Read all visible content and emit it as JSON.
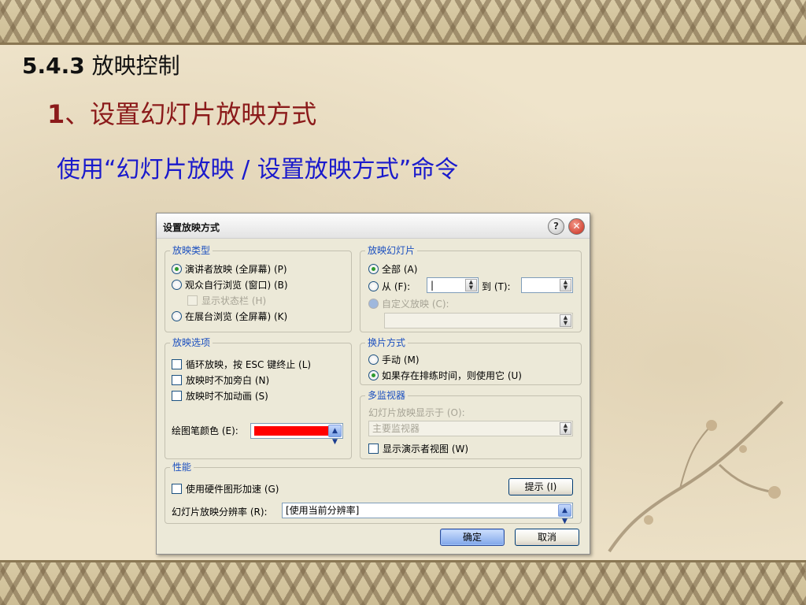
{
  "slide": {
    "heading1_num": "5.4.3",
    "heading1_text": " 放映控制",
    "heading2_num": "1",
    "heading2_text": "、设置幻灯片放映方式",
    "heading3_text": "使用“幻灯片放映 / 设置放映方式”命令"
  },
  "dialog": {
    "title": "设置放映方式",
    "help_icon": "?",
    "close_icon": "✕",
    "show_type": {
      "title": "放映类型",
      "options": [
        {
          "label": "演讲者放映 (全屏幕) (P)",
          "selected": true
        },
        {
          "label": "观众自行浏览 (窗口) (B)",
          "selected": false
        },
        {
          "label": "显示状态栏 (H)",
          "checked": false,
          "disabled": true
        },
        {
          "label": "在展台浏览 (全屏幕) (K)",
          "selected": false
        }
      ]
    },
    "show_slides": {
      "title": "放映幻灯片",
      "all_label": "全部 (A)",
      "from_label": "从 (F):",
      "from_value": "|",
      "to_label": "到 (T):",
      "to_value": "",
      "custom_label": "自定义放映 (C):",
      "custom_value": ""
    },
    "show_options": {
      "title": "放映选项",
      "loop_label": "循环放映，按 ESC 键终止 (L)",
      "no_narration_label": "放映时不加旁白 (N)",
      "no_animation_label": "放映时不加动画 (S)",
      "pen_color_label": "绘图笔颜色 (E):",
      "pen_color": "#ff0000"
    },
    "advance_slides": {
      "title": "换片方式",
      "manual_label": "手动 (M)",
      "timings_label": "如果存在排练时间，则使用它 (U)"
    },
    "multiple_monitors": {
      "title": "多监视器",
      "display_on_label": "幻灯片放映显示于 (O):",
      "display_value": "主要监视器",
      "presenter_view_label": "显示演示者视图 (W)"
    },
    "performance": {
      "title": "性能",
      "hw_accel_label": "使用硬件图形加速 (G)",
      "tips_button": "提示 (I)",
      "resolution_label": "幻灯片放映分辨率 (R):",
      "resolution_value": "[使用当前分辨率]"
    },
    "ok_button": "确定",
    "cancel_button": "取消"
  }
}
